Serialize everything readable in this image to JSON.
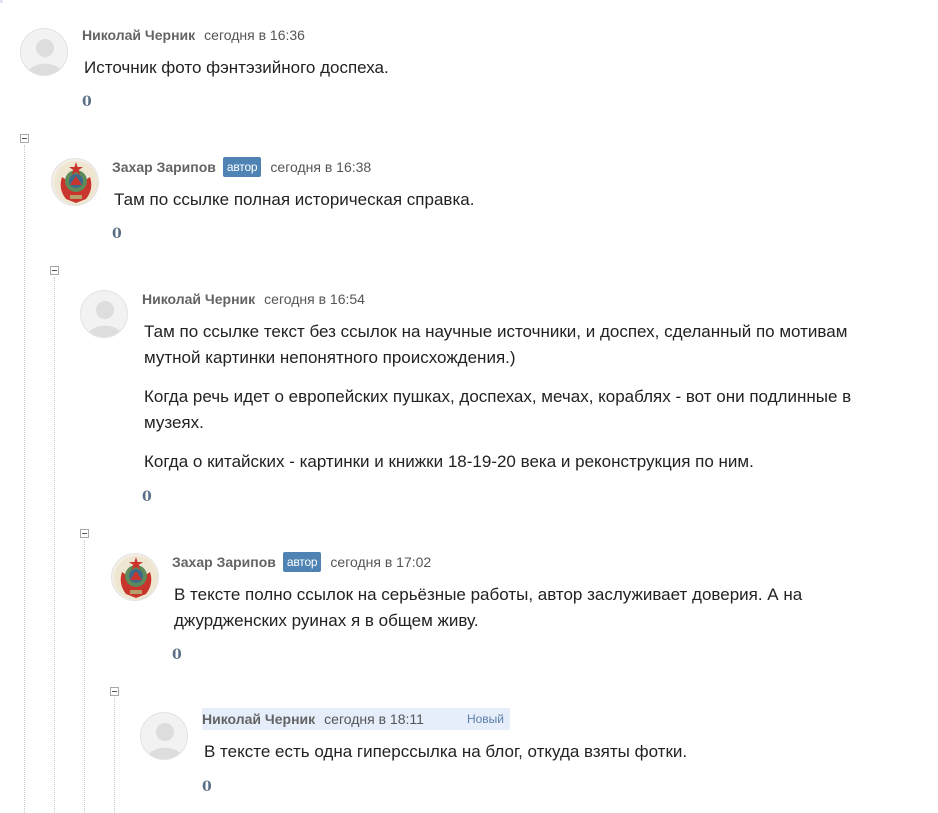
{
  "comments": [
    {
      "author": "Николай Черник",
      "date": "сегодня в 16:36",
      "paragraphs": [
        "Источник фото фэнтэзийного доспеха."
      ],
      "rating": "0"
    },
    {
      "author": "Захар Зарипов",
      "badge": "автор",
      "date": "сегодня в 16:38",
      "paragraphs": [
        "Там по ссылке полная историческая справка."
      ],
      "rating": "0"
    },
    {
      "author": "Николай Черник",
      "date": "сегодня в 16:54",
      "paragraphs": [
        "Там по ссылке текст без ссылок на научные источники, и доспех, сделанный по мотивам мутной картинки непонятного происхождения.)",
        "Когда речь идет о европейских пушках, доспехах, мечах, кораблях - вот они подлинные в музеях.",
        "Когда о китайских - картинки и книжки 18-19-20 века и реконструкция по ним."
      ],
      "rating": "0"
    },
    {
      "author": "Захар Зарипов",
      "badge": "автор",
      "date": "сегодня в 17:02",
      "paragraphs": [
        "В тексте полно ссылок на серьёзные работы, автор заслуживает доверия. А на джурдженских руинах я в общем живу."
      ],
      "rating": "0"
    },
    {
      "author": "Николай Черник",
      "date": "сегодня в 18:11",
      "new_label": "Новый",
      "paragraphs": [
        "В тексте есть одна гиперссылка на блог, откуда взяты фотки."
      ],
      "rating": "0"
    }
  ],
  "icons": {
    "default_avatar": "default-user-avatar-icon",
    "emblem_avatar": "soviet-emblem-avatar-icon",
    "collapse": "minus-square-icon"
  },
  "colors": {
    "badge_bg": "#4e83b3",
    "new_highlight": "#e6eefb",
    "author_text": "#646464",
    "rating_text": "#5a6f86"
  }
}
